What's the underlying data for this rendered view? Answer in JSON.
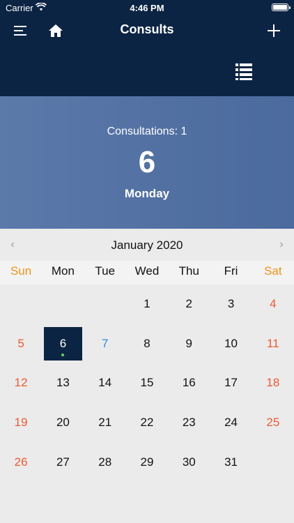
{
  "status_bar": {
    "carrier": "Carrier",
    "time": "4:46 PM"
  },
  "header": {
    "title": "Consults"
  },
  "icons": {
    "menu": "menu-icon",
    "home": "home-icon",
    "add": "plus-icon",
    "list": "list-icon",
    "wifi": "wifi-icon",
    "battery": "battery-icon"
  },
  "summary": {
    "consultations": "Consultations: 1",
    "day_number": "6",
    "day_name": "Monday"
  },
  "calendar": {
    "month": "January 2020",
    "prev": "‹",
    "next": "›",
    "weekdays": [
      "Sun",
      "Mon",
      "Tue",
      "Wed",
      "Thu",
      "Fri",
      "Sat"
    ],
    "weeks": [
      [
        "",
        "",
        "",
        "1",
        "2",
        "3",
        "4"
      ],
      [
        "5",
        "6",
        "7",
        "8",
        "9",
        "10",
        "11"
      ],
      [
        "12",
        "13",
        "14",
        "15",
        "16",
        "17",
        "18"
      ],
      [
        "19",
        "20",
        "21",
        "22",
        "23",
        "24",
        "25"
      ],
      [
        "26",
        "27",
        "28",
        "29",
        "30",
        "31",
        ""
      ]
    ],
    "selected_day": "6",
    "today": "7",
    "event_days": [
      "6"
    ]
  },
  "colors": {
    "navy": "#0c2444",
    "summary_blue": "#5273a4",
    "weekend_header": "#f29118",
    "weekend_day": "#eb5a33",
    "today_day": "#2b8be8",
    "event_dot": "#63d65e"
  }
}
